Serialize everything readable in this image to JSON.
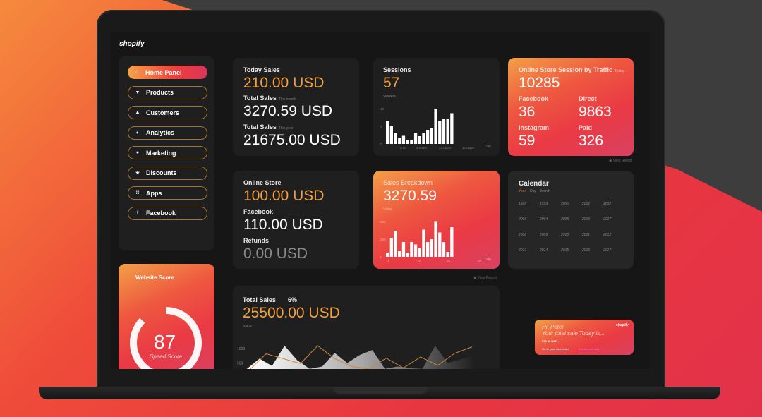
{
  "brand": "shopify",
  "sidebar": {
    "items": [
      {
        "label": "Home Panel",
        "icon": "home-icon",
        "glyph": "⌂",
        "active": true
      },
      {
        "label": "Products",
        "icon": "shirt-icon",
        "glyph": "▼",
        "active": false
      },
      {
        "label": "Customers",
        "icon": "user-icon",
        "glyph": "▲",
        "active": false
      },
      {
        "label": "Analytics",
        "icon": "pie-chart-icon",
        "glyph": "◐",
        "active": false
      },
      {
        "label": "Marketing",
        "icon": "chat-bubble-icon",
        "glyph": "●",
        "active": false
      },
      {
        "label": "Discounts",
        "icon": "star-icon",
        "glyph": "★",
        "active": false
      },
      {
        "label": "Apps",
        "icon": "apps-grid-icon",
        "glyph": "⁞⁞",
        "active": false
      },
      {
        "label": "Facebook",
        "icon": "facebook-icon",
        "glyph": "f",
        "active": false
      }
    ]
  },
  "sales_card": {
    "today_label": "Today Sales",
    "today_value": "210.00 USD",
    "month_label": "Total Sales",
    "month_sub": "This month",
    "month_value": "3270.59 USD",
    "year_label": "Total Sales",
    "year_sub": "This year",
    "year_value": "21675.00 USD"
  },
  "sessions_card": {
    "title": "Sessions",
    "value": "57",
    "sub": "Viewers",
    "chart_data": {
      "type": "bar",
      "ylabel": "Viewers",
      "xlabel": "Day",
      "yticks": [
        "0",
        "5",
        "10"
      ],
      "ylim": [
        0,
        10
      ],
      "xticks": [
        "0.00",
        "6.00am",
        "12.00pm",
        "12.00pm"
      ],
      "values": [
        6.5,
        5,
        3.2,
        1.6,
        2.3,
        1.1,
        1.1,
        3.2,
        2.2,
        3.2,
        4,
        4.6,
        10,
        6.6,
        7.2,
        7.2,
        8.7
      ]
    }
  },
  "traffic_card": {
    "title": "Online Store Session by Traffic",
    "title_sub": "Today",
    "total": "10285",
    "sources": [
      {
        "label": "Facebook",
        "value": "36"
      },
      {
        "label": "Direct",
        "value": "9863"
      },
      {
        "label": "Instagram",
        "value": "59"
      },
      {
        "label": "Paid",
        "value": "326"
      }
    ],
    "view_report": "View Report"
  },
  "store_card": {
    "online_label": "Online Store",
    "online_value": "100.00 USD",
    "facebook_label": "Facebook",
    "facebook_value": "110.00 USD",
    "refunds_label": "Refunds",
    "refunds_value": "0.00 USD"
  },
  "breakdown_card": {
    "title": "Sales Breakdown",
    "value": "3270.59",
    "sub": "Value",
    "view_report": "View Report",
    "chart_data": {
      "type": "bar",
      "ylabel": "Value",
      "xlabel": "Day",
      "yticks": [
        "0",
        "250",
        "500"
      ],
      "ylim": [
        0,
        500
      ],
      "xticks": [
        "1",
        "10",
        "20",
        "30"
      ],
      "values": [
        60,
        270,
        370,
        80,
        210,
        60,
        210,
        175,
        120,
        385,
        210,
        250,
        505,
        345,
        210,
        70,
        420
      ]
    }
  },
  "calendar_card": {
    "title": "Calendar",
    "tabs": [
      {
        "label": "Year",
        "active": true
      },
      {
        "label": "Day",
        "active": false
      },
      {
        "label": "Month",
        "active": false
      }
    ],
    "years": [
      "1998",
      "1999",
      "2000",
      "2001",
      "2002",
      "2003",
      "2004",
      "2005",
      "2006",
      "2007",
      "2008",
      "2009",
      "2010",
      "2011",
      "2012",
      "2013",
      "2014",
      "2015",
      "2016",
      "2017"
    ]
  },
  "score_card": {
    "title": "Website Score",
    "value": "87",
    "sub": "Speed Score",
    "score_fraction": 0.87
  },
  "total_card": {
    "label": "Total Sales",
    "percent": "6%",
    "value": "25500.00 USD",
    "sub": "Value",
    "chart_data": {
      "type": "area",
      "ylabel": "Value",
      "yticks": [
        "500",
        "1000"
      ],
      "area_values": [
        300,
        650,
        400,
        1100,
        600,
        300,
        380,
        850,
        500,
        780,
        950,
        300,
        380,
        320,
        300,
        1100,
        500,
        620,
        750
      ],
      "line_values": [
        250,
        820,
        650,
        480,
        1100,
        650,
        380,
        300,
        670,
        330,
        710,
        420,
        840,
        1060
      ]
    }
  },
  "notification": {
    "greeting": "Hi, Peter",
    "message": "Your total sale Today is...",
    "amount": "$10.00 USD",
    "brand": "shopify",
    "link_dashboard": "Go to your dashboard",
    "link_remind": "Remind me later"
  },
  "colors": {
    "accent_orange": "#f2a040",
    "accent_red": "#ea3a44",
    "nav_border": "#a5742e"
  }
}
